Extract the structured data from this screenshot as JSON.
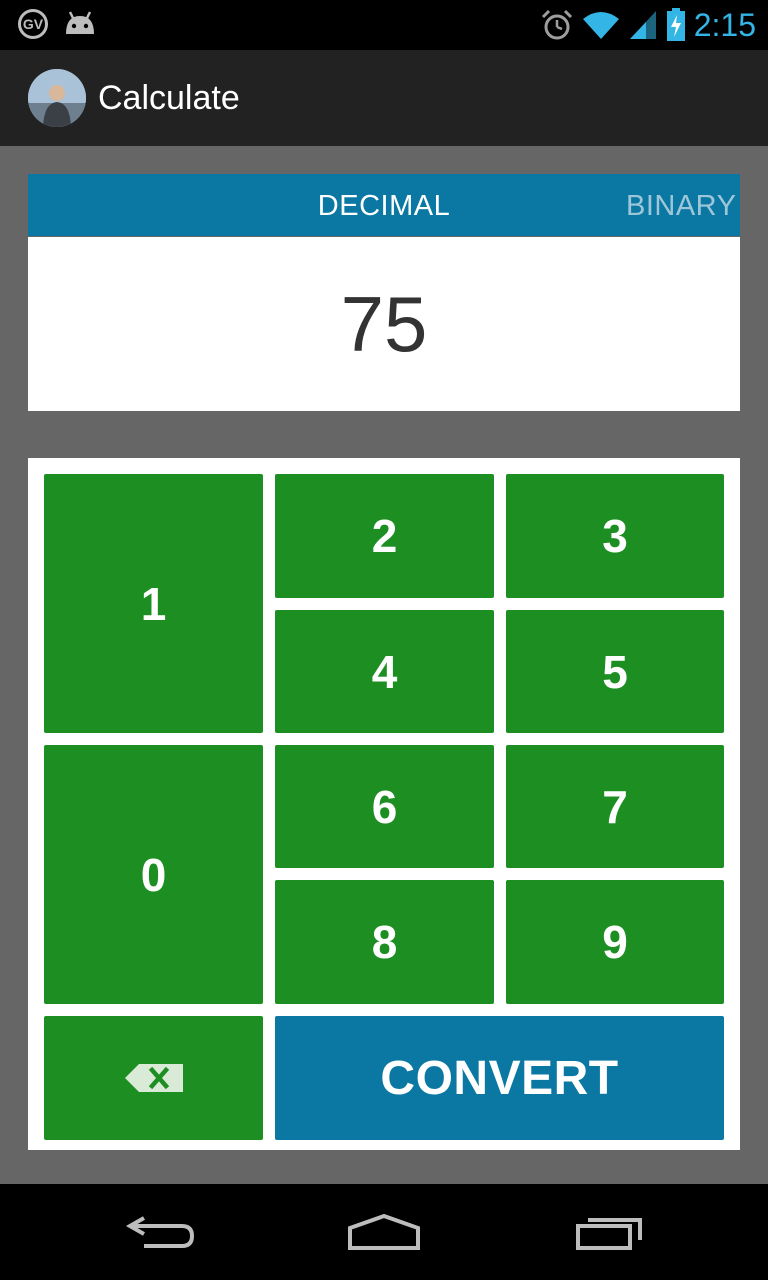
{
  "status_bar": {
    "time": "2:15",
    "gv_badge": "GV"
  },
  "action_bar": {
    "title": "Calculate"
  },
  "tabs": [
    {
      "label": "DECIMAL",
      "active": true
    },
    {
      "label": "BINARY",
      "active": false
    }
  ],
  "display": {
    "value": "75"
  },
  "keypad": {
    "keys": [
      "1",
      "2",
      "3",
      "4",
      "5",
      "0",
      "6",
      "7",
      "8",
      "9"
    ],
    "backspace_icon": "backspace-icon",
    "convert_label": "CONVERT"
  },
  "colors": {
    "key_green": "#1d8f22",
    "accent_blue": "#0b78a3",
    "status_blue": "#33b5e5",
    "background": "#666666"
  }
}
